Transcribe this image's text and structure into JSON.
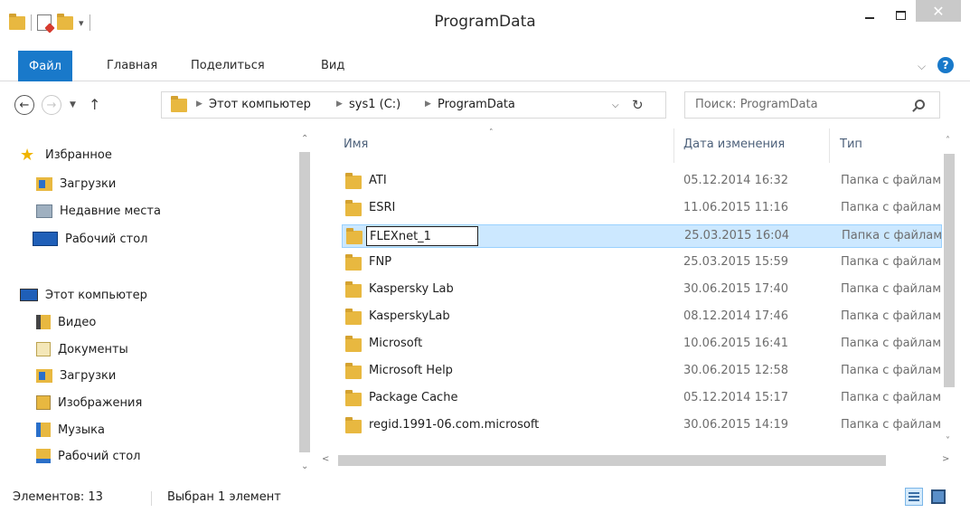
{
  "window": {
    "title": "ProgramData"
  },
  "title_controls": {
    "minimize": "–",
    "maximize": "□",
    "close": "✕",
    "qat_dropdown": "▾"
  },
  "ribbon": {
    "tabs": [
      "Файл",
      "Главная",
      "Поделиться",
      "Вид"
    ],
    "active_tab": "Файл",
    "expand_glyph": "⌵",
    "help_glyph": "?"
  },
  "navigation": {
    "back": "←",
    "forward": "→",
    "recent": "▼",
    "up": "↑"
  },
  "address_bar": {
    "breadcrumbs": [
      "Этот компьютер",
      "sys1 (C:)",
      "ProgramData"
    ],
    "separator": "▶",
    "dropdown": "⌵",
    "refresh": "↻"
  },
  "search": {
    "placeholder": "Поиск: ProgramData"
  },
  "sidebar": {
    "favorites": {
      "label": "Избранное",
      "items": [
        "Загрузки",
        "Недавние места",
        "Рабочий стол"
      ]
    },
    "this_pc": {
      "label": "Этот компьютер",
      "items": [
        "Видео",
        "Документы",
        "Загрузки",
        "Изображения",
        "Музыка",
        "Рабочий стол"
      ]
    },
    "scroll_up": "⌃",
    "scroll_down": "⌄"
  },
  "file_list": {
    "columns": [
      "Имя",
      "Дата изменения",
      "Тип"
    ],
    "sort_indicator": "˄",
    "rows": [
      {
        "name": "ATI",
        "date": "05.12.2014 16:32",
        "type": "Папка с файлами"
      },
      {
        "name": "ESRI",
        "date": "11.06.2015 11:16",
        "type": "Папка с файлами"
      },
      {
        "name": "FLEXnet_1",
        "date": "25.03.2015 16:04",
        "type": "Папка с файлами"
      },
      {
        "name": "FNP",
        "date": "25.03.2015 15:59",
        "type": "Папка с файлами"
      },
      {
        "name": "Kaspersky Lab",
        "date": "30.06.2015 17:40",
        "type": "Папка с файлами"
      },
      {
        "name": "KasperskyLab",
        "date": "08.12.2014 17:46",
        "type": "Папка с файлами"
      },
      {
        "name": "Microsoft",
        "date": "10.06.2015 16:41",
        "type": "Папка с файлами"
      },
      {
        "name": "Microsoft Help",
        "date": "30.06.2015 12:58",
        "type": "Папка с файлами"
      },
      {
        "name": "Package Cache",
        "date": "05.12.2014 15:17",
        "type": "Папка с файлами"
      },
      {
        "name": "regid.1991-06.com.microsoft",
        "date": "30.06.2015 14:19",
        "type": "Папка с файлами"
      }
    ],
    "selected_index": 2,
    "rename_value": "FLEXnet_1",
    "scroll_up": "˄",
    "scroll_down": "˅",
    "scroll_left": "<",
    "scroll_right": ">"
  },
  "status_bar": {
    "count": "Элементов: 13",
    "selected": "Выбран 1 элемент"
  },
  "colors": {
    "accent": "#1979ca",
    "selection_bg": "#cce8ff",
    "selection_border": "#99d1ff",
    "folder": "#e8b840"
  },
  "icons": {
    "favorites": "star-icon",
    "folder": "folder-icon",
    "this_pc": "computer-icon",
    "search": "search-icon",
    "help": "help-icon"
  }
}
